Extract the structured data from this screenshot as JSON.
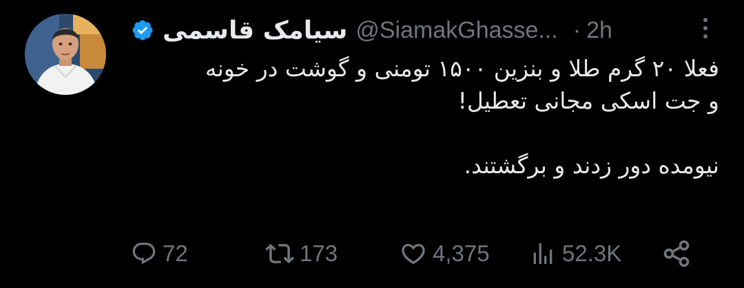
{
  "author": {
    "display_name": "سیامک قاسمی",
    "handle": "@SiamakGhasse...",
    "verified": true,
    "time": "2h",
    "separator": "·"
  },
  "tweet": {
    "paragraphs": [
      "فعلا ۲۰ گرم طلا و بنزین ۱۵۰۰ تومنی و گوشت در خونه",
      "و جت اسکی مجانی تعطیل!",
      "نیومده دور زدند و برگشتند."
    ]
  },
  "actions": {
    "replies": "72",
    "retweets": "173",
    "likes": "4,375",
    "views": "52.3K"
  },
  "icons": {
    "reply": "reply-icon",
    "retweet": "retweet-icon",
    "like": "heart-icon",
    "views": "views-icon",
    "share": "share-icon",
    "more": "more-icon",
    "verified": "verified-badge-icon"
  },
  "colors": {
    "background": "#000000",
    "text": "#e7e9ea",
    "muted": "#71767b",
    "verified": "#1d9bf0"
  }
}
